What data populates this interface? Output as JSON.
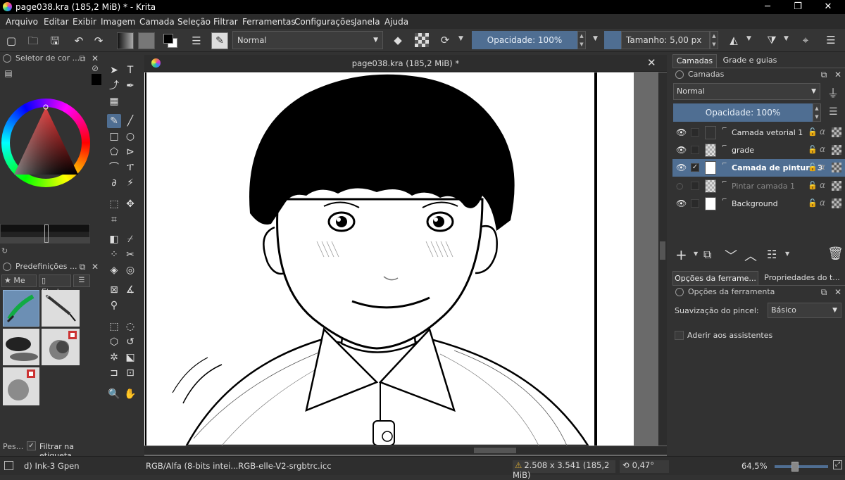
{
  "window": {
    "title": "page038.kra (185,2 MiB) * - Krita"
  },
  "menu": [
    "Arquivo",
    "Editar",
    "Exibir",
    "Imagem",
    "Camada",
    "Seleção",
    "Filtrar",
    "Ferramentas",
    "Configurações",
    "Janela",
    "Ajuda"
  ],
  "toolbar": {
    "blend_mode": "Normal",
    "opacity": "Opacidade: 100%",
    "size": "Tamanho: 5,00 px"
  },
  "color_docker": {
    "title": "Seletor de cor ..."
  },
  "presets_docker": {
    "title": "Predefinições ...",
    "tag_filter": "Me",
    "tag_label": "Et...ta",
    "search_label": "Pes...",
    "filter_label": "Filtrar na etiqueta",
    "filter_checked": true
  },
  "document": {
    "tab_title": "page038.kra (185,2 MiB) *"
  },
  "right_tabs": [
    "Camadas",
    "Grade e guias"
  ],
  "layers": {
    "title": "Camadas",
    "blend_mode": "Normal",
    "opacity": "Opacidade: 100%",
    "items": [
      {
        "name": "Camada vetorial 1",
        "visible": true,
        "active": false,
        "thumb": "vector"
      },
      {
        "name": "grade",
        "visible": true,
        "active": false,
        "thumb": "checker"
      },
      {
        "name": "Camada de pintura 3",
        "visible": true,
        "active": true,
        "thumb": "white"
      },
      {
        "name": "Pintar camada 1",
        "visible": false,
        "active": false,
        "thumb": "checker"
      },
      {
        "name": "Background",
        "visible": true,
        "active": false,
        "thumb": "white"
      }
    ]
  },
  "tool_options": {
    "tabs": [
      "Opções da ferrame...",
      "Propriedades do t..."
    ],
    "title": "Opções da ferramenta",
    "smoothing_label": "Suavização do pincel:",
    "smoothing_value": "Básico",
    "snap_label": "Aderir aos assistentes",
    "snap_checked": false
  },
  "status": {
    "brush": "d) Ink-3 Gpen",
    "color_space": "RGB/Alfa (8-bits intei...RGB-elle-V2-srgbtrc.icc",
    "dimensions": "2.508 x 3.541 (185,2 MiB)",
    "rotation": "0,47°",
    "zoom": "64,5%"
  },
  "colors": {
    "accent": "#4f6e92",
    "bg": "#323232"
  }
}
